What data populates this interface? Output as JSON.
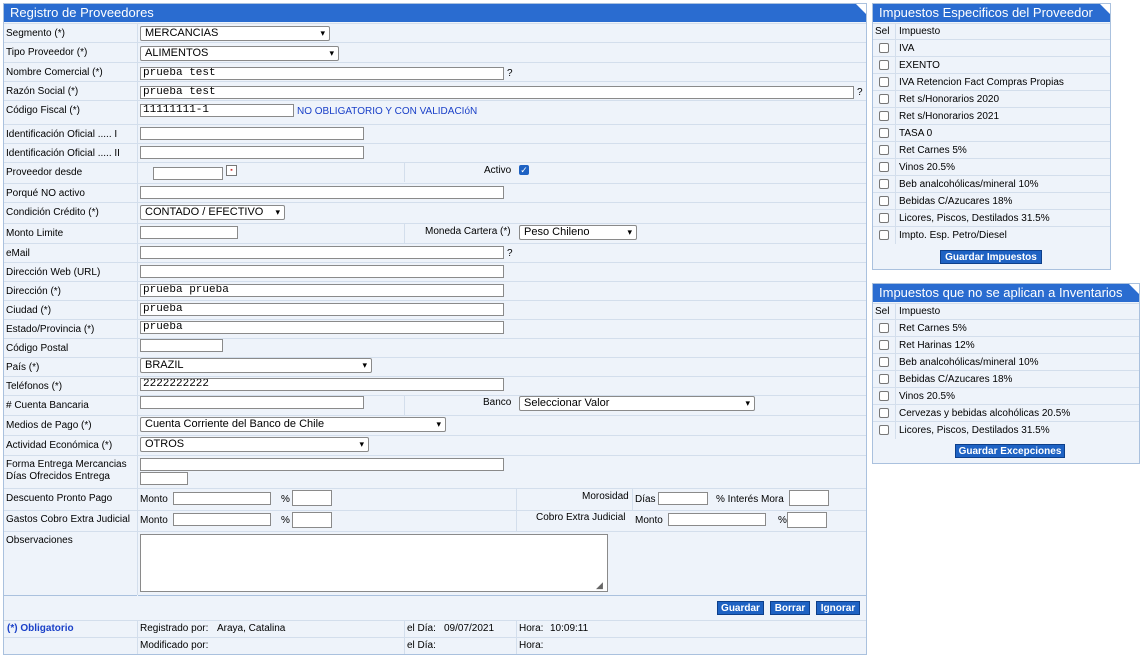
{
  "main": {
    "title": "Registro de Proveedores",
    "segmento": {
      "label": "Segmento (*)",
      "value": "MERCANCIAS"
    },
    "tipo": {
      "label": "Tipo Proveedor (*)",
      "value": "ALIMENTOS"
    },
    "nombre": {
      "label": "Nombre Comercial (*)",
      "value": "prueba test"
    },
    "razon": {
      "label": "Razón Social (*)",
      "value": "prueba test"
    },
    "fiscal": {
      "label": "Código Fiscal (*)",
      "value": "11111111-1",
      "note": "NO OBLIGATORIO Y CON VALIDACIóN"
    },
    "ident1": {
      "label": "Identificación Oficial ..... I",
      "value": ""
    },
    "ident2": {
      "label": "Identificación Oficial ..... II",
      "value": ""
    },
    "desde": {
      "label": "Proveedor desde",
      "value": ""
    },
    "activo": {
      "label": "Activo",
      "checked": true
    },
    "noactivo": {
      "label": "Porqué NO activo",
      "value": ""
    },
    "credito": {
      "label": "Condición Crédito (*)",
      "value": "CONTADO / EFECTIVO"
    },
    "monto": {
      "label": "Monto Limite",
      "value": ""
    },
    "moneda": {
      "label": "Moneda Cartera (*)",
      "value": "Peso Chileno"
    },
    "email": {
      "label": "eMail",
      "value": ""
    },
    "web": {
      "label": "Dirección Web (URL)",
      "value": ""
    },
    "direccion": {
      "label": "Dirección (*)",
      "value": "prueba prueba"
    },
    "ciudad": {
      "label": "Ciudad (*)",
      "value": "prueba"
    },
    "estado": {
      "label": "Estado/Provincia (*)",
      "value": "prueba"
    },
    "postal": {
      "label": "Código Postal",
      "value": ""
    },
    "pais": {
      "label": "País (*)",
      "value": "BRAZIL"
    },
    "telefonos": {
      "label": "Teléfonos (*)",
      "value": "2222222222"
    },
    "cuenta": {
      "label": "# Cuenta Bancaria",
      "value": ""
    },
    "banco": {
      "label": "Banco",
      "value": "Seleccionar Valor"
    },
    "medios": {
      "label": "Medios de Pago (*)",
      "value": "Cuenta Corriente del Banco de Chile"
    },
    "actividad": {
      "label": "Actividad Económica (*)",
      "value": "OTROS"
    },
    "entrega": {
      "label1": "Forma Entrega Mercancias",
      "label2": "Días Ofrecidos Entrega",
      "value": ""
    },
    "descuento": {
      "label": "Descuento Pronto Pago",
      "monto_label": "Monto",
      "pct": "%"
    },
    "morosidad": {
      "label": "Morosidad",
      "dias_label": "Días",
      "interes_label": "% Interés Mora"
    },
    "gastos": {
      "label": "Gastos Cobro Extra Judicial",
      "monto_label": "Monto",
      "pct": "%"
    },
    "cobro": {
      "label": "Cobro Extra Judicial",
      "monto_label": "Monto",
      "pct": "%"
    },
    "observaciones": {
      "label": "Observaciones",
      "value": ""
    },
    "buttons": {
      "guardar": "Guardar",
      "borrar": "Borrar",
      "ignorar": "Ignorar"
    },
    "footer": {
      "obligatorio": "(*) Obligatorio",
      "registrado_label": "Registrado por:",
      "registrado_value": "Araya, Catalina",
      "dia_label": "el Día:",
      "dia_value": "09/07/2021",
      "hora_label": "Hora:",
      "hora_value": "10:09:11",
      "modificado_label": "Modificado por:",
      "dia2_label": "el Día:",
      "hora2_label": "Hora:"
    },
    "q": "?"
  },
  "impuestos": {
    "title": "Impuestos Especificos del Proveedor",
    "col_sel": "Sel",
    "col_imp": "Impuesto",
    "items": [
      "IVA",
      "EXENTO",
      "IVA Retencion Fact Compras Propias",
      "Ret s/Honorarios 2020",
      "Ret s/Honorarios 2021",
      "TASA 0",
      "Ret Carnes 5%",
      "Vinos 20.5%",
      "Beb analcohólicas/mineral 10%",
      "Bebidas C/Azucares 18%",
      "Licores, Piscos, Destilados 31.5%",
      "Impto. Esp. Petro/Diesel"
    ],
    "button": "Guardar Impuestos"
  },
  "excepciones": {
    "title": "Impuestos que no se aplican a Inventarios",
    "col_sel": "Sel",
    "col_imp": "Impuesto",
    "items": [
      "Ret Carnes 5%",
      "Ret Harinas 12%",
      "Beb analcohólicas/mineral 10%",
      "Bebidas C/Azucares 18%",
      "Vinos 20.5%",
      "Cervezas y bebidas alcohólicas 20.5%",
      "Licores, Piscos, Destilados 31.5%"
    ],
    "button": "Guardar Excepciones"
  }
}
